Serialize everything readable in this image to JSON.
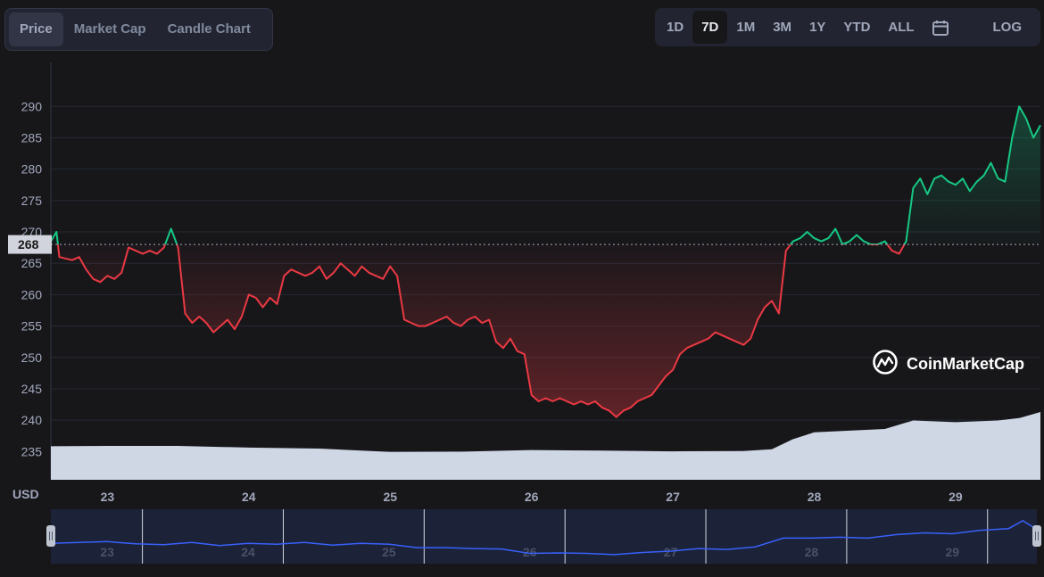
{
  "tabs": [
    {
      "label": "Price",
      "active": true
    },
    {
      "label": "Market Cap",
      "active": false
    },
    {
      "label": "Candle Chart",
      "active": false
    }
  ],
  "ranges": [
    {
      "label": "1D",
      "active": false
    },
    {
      "label": "7D",
      "active": true
    },
    {
      "label": "1M",
      "active": false
    },
    {
      "label": "3M",
      "active": false
    },
    {
      "label": "1Y",
      "active": false
    },
    {
      "label": "YTD",
      "active": false
    },
    {
      "label": "ALL",
      "active": false
    }
  ],
  "calendar_icon": "calendar-icon",
  "log_label": "LOG",
  "watermark": {
    "text": "CoinMarketCap",
    "icon": "coinmarketcap-logo-icon"
  },
  "colors": {
    "up": "#16c784",
    "down": "#ea3943",
    "navigator_line": "#3861fb",
    "volume": "#cfd6e4",
    "background": "#17171a"
  },
  "chart_data": {
    "type": "line",
    "currency_label": "USD",
    "baseline_price": 268,
    "baseline_label": "268",
    "ylim": [
      230.5,
      297
    ],
    "yticks": [
      235,
      240,
      245,
      250,
      255,
      260,
      265,
      270,
      275,
      280,
      285,
      290
    ],
    "xlim": [
      22.6,
      29.6
    ],
    "xticks": [
      23,
      24,
      25,
      26,
      27,
      28,
      29
    ],
    "series": [
      {
        "x": [
          22.6,
          22.64,
          22.66,
          22.75,
          22.8,
          22.85,
          22.9,
          22.95,
          23.0,
          23.05,
          23.1,
          23.15,
          23.2,
          23.25,
          23.3,
          23.35,
          23.4,
          23.45,
          23.5,
          23.55,
          23.6,
          23.65,
          23.7,
          23.75,
          23.8,
          23.85,
          23.9,
          23.95,
          24.0,
          24.05,
          24.1,
          24.15,
          24.2,
          24.25,
          24.3,
          24.35,
          24.4,
          24.45,
          24.5,
          24.55,
          24.6,
          24.65,
          24.7,
          24.75,
          24.8,
          24.85,
          24.9,
          24.95,
          25.0,
          25.05,
          25.1,
          25.15,
          25.2,
          25.25,
          25.3,
          25.35,
          25.4,
          25.45,
          25.5,
          25.55,
          25.6,
          25.65,
          25.7,
          25.75,
          25.8,
          25.85,
          25.9,
          25.95,
          26.0,
          26.05,
          26.1,
          26.15,
          26.2,
          26.25,
          26.3,
          26.35,
          26.4,
          26.45,
          26.5,
          26.55,
          26.6,
          26.65,
          26.7,
          26.75,
          26.8,
          26.85,
          26.9,
          26.95,
          27.0,
          27.05,
          27.1,
          27.15,
          27.2,
          27.25,
          27.3,
          27.35,
          27.4,
          27.45,
          27.5,
          27.55,
          27.6,
          27.65,
          27.7,
          27.75,
          27.8,
          27.85,
          27.9,
          27.95,
          28.0,
          28.05,
          28.1,
          28.15,
          28.2,
          28.25,
          28.3,
          28.35,
          28.4,
          28.45,
          28.5,
          28.55,
          28.6,
          28.65,
          28.7,
          28.75,
          28.8,
          28.85,
          28.9,
          28.95,
          29.0,
          29.05,
          29.1,
          29.15,
          29.2,
          29.25,
          29.3,
          29.35,
          29.4,
          29.45,
          29.5,
          29.55,
          29.6
        ],
        "y": [
          268.5,
          270.0,
          266.0,
          265.5,
          266.0,
          264.0,
          262.5,
          262.0,
          263.0,
          262.5,
          263.5,
          267.5,
          267.0,
          266.5,
          267.0,
          266.5,
          267.5,
          270.5,
          267.5,
          257.0,
          255.5,
          256.5,
          255.5,
          254.0,
          255.0,
          256.0,
          254.5,
          256.5,
          260.0,
          259.5,
          258.0,
          259.5,
          258.5,
          263.0,
          264.0,
          263.5,
          263.0,
          263.5,
          264.5,
          262.5,
          263.5,
          265.0,
          264.0,
          263.0,
          264.5,
          263.5,
          263.0,
          262.5,
          264.5,
          263.0,
          256.0,
          255.5,
          255.0,
          255.0,
          255.5,
          256.0,
          256.5,
          255.5,
          255.0,
          256.0,
          256.5,
          255.5,
          256.0,
          252.5,
          251.5,
          253.0,
          251.0,
          250.5,
          244.0,
          243.0,
          243.5,
          243.0,
          243.5,
          243.0,
          242.5,
          243.0,
          242.5,
          243.0,
          242.0,
          241.5,
          240.5,
          241.5,
          242.0,
          243.0,
          243.5,
          244.0,
          245.5,
          247.0,
          248.0,
          250.5,
          251.5,
          252.0,
          252.5,
          253.0,
          254.0,
          253.5,
          253.0,
          252.5,
          252.0,
          253.0,
          256.0,
          258.0,
          259.0,
          257.0,
          267.0,
          268.5,
          269.0,
          270.0,
          269.0,
          268.5,
          269.0,
          270.5,
          268.0,
          268.5,
          269.5,
          268.5,
          268.0,
          268.0,
          268.5,
          267.0,
          266.5,
          268.5,
          277.0,
          278.5,
          276.0,
          278.5,
          279.0,
          278.0,
          277.5,
          278.5,
          276.5,
          278.0,
          279.0,
          281.0,
          278.5,
          278.0,
          285.0,
          290.0,
          288.0,
          285.0,
          287.0
        ]
      }
    ],
    "volume": {
      "x": [
        22.6,
        23.0,
        23.5,
        24.0,
        24.5,
        25.0,
        25.5,
        26.0,
        26.5,
        27.0,
        27.5,
        27.7,
        27.85,
        28.0,
        28.5,
        28.7,
        29.0,
        29.3,
        29.45,
        29.6
      ],
      "v": [
        0.99,
        1.0,
        1.0,
        0.95,
        0.92,
        0.82,
        0.83,
        0.88,
        0.86,
        0.84,
        0.85,
        0.9,
        1.2,
        1.4,
        1.5,
        1.75,
        1.7,
        1.75,
        1.82,
        2.0
      ]
    },
    "navigator": {
      "x": [
        22.6,
        22.8,
        23.0,
        23.2,
        23.4,
        23.6,
        23.8,
        24.0,
        24.2,
        24.4,
        24.6,
        24.8,
        25.0,
        25.2,
        25.4,
        25.6,
        25.8,
        26.0,
        26.2,
        26.4,
        26.6,
        26.8,
        27.0,
        27.2,
        27.4,
        27.6,
        27.8,
        28.0,
        28.2,
        28.4,
        28.6,
        28.8,
        29.0,
        29.2,
        29.4,
        29.5,
        29.6
      ],
      "y": [
        0.62,
        0.6,
        0.58,
        0.63,
        0.65,
        0.6,
        0.67,
        0.62,
        0.64,
        0.6,
        0.66,
        0.62,
        0.64,
        0.72,
        0.72,
        0.74,
        0.75,
        0.85,
        0.84,
        0.85,
        0.88,
        0.83,
        0.8,
        0.74,
        0.76,
        0.7,
        0.5,
        0.5,
        0.48,
        0.5,
        0.42,
        0.38,
        0.4,
        0.32,
        0.28,
        0.1,
        0.3
      ],
      "handles": [
        22.6,
        29.6
      ]
    }
  }
}
